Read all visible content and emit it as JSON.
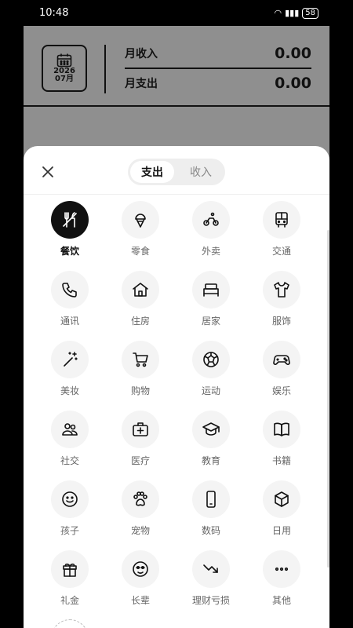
{
  "status_bar": {
    "time": "10:48",
    "battery": "58"
  },
  "summary": {
    "year": "2026",
    "month": "07月",
    "income_label": "月收入",
    "income_value": "0.00",
    "expense_label": "月支出",
    "expense_value": "0.00"
  },
  "sheet": {
    "tabs": [
      {
        "label": "支出",
        "active": true
      },
      {
        "label": "收入",
        "active": false
      }
    ],
    "categories": [
      {
        "label": "餐饮",
        "icon": "utensils-icon",
        "selected": true
      },
      {
        "label": "零食",
        "icon": "ice-cream-icon"
      },
      {
        "label": "外卖",
        "icon": "delivery-bike-icon"
      },
      {
        "label": "交通",
        "icon": "bus-icon"
      },
      {
        "label": "通讯",
        "icon": "phone-icon"
      },
      {
        "label": "住房",
        "icon": "house-icon"
      },
      {
        "label": "居家",
        "icon": "bed-icon"
      },
      {
        "label": "服饰",
        "icon": "shirt-icon"
      },
      {
        "label": "美妆",
        "icon": "magic-wand-icon"
      },
      {
        "label": "购物",
        "icon": "cart-icon"
      },
      {
        "label": "运动",
        "icon": "soccer-ball-icon"
      },
      {
        "label": "娱乐",
        "icon": "gamepad-icon"
      },
      {
        "label": "社交",
        "icon": "people-icon"
      },
      {
        "label": "医疗",
        "icon": "first-aid-icon"
      },
      {
        "label": "教育",
        "icon": "graduation-cap-icon"
      },
      {
        "label": "书籍",
        "icon": "book-icon"
      },
      {
        "label": "孩子",
        "icon": "smiley-face-icon"
      },
      {
        "label": "宠物",
        "icon": "paw-icon"
      },
      {
        "label": "数码",
        "icon": "smartphone-icon"
      },
      {
        "label": "日用",
        "icon": "cube-icon"
      },
      {
        "label": "礼金",
        "icon": "gift-icon"
      },
      {
        "label": "长辈",
        "icon": "elder-face-icon"
      },
      {
        "label": "理财亏损",
        "icon": "trend-down-icon"
      },
      {
        "label": "其他",
        "icon": "more-dots-icon"
      }
    ]
  }
}
